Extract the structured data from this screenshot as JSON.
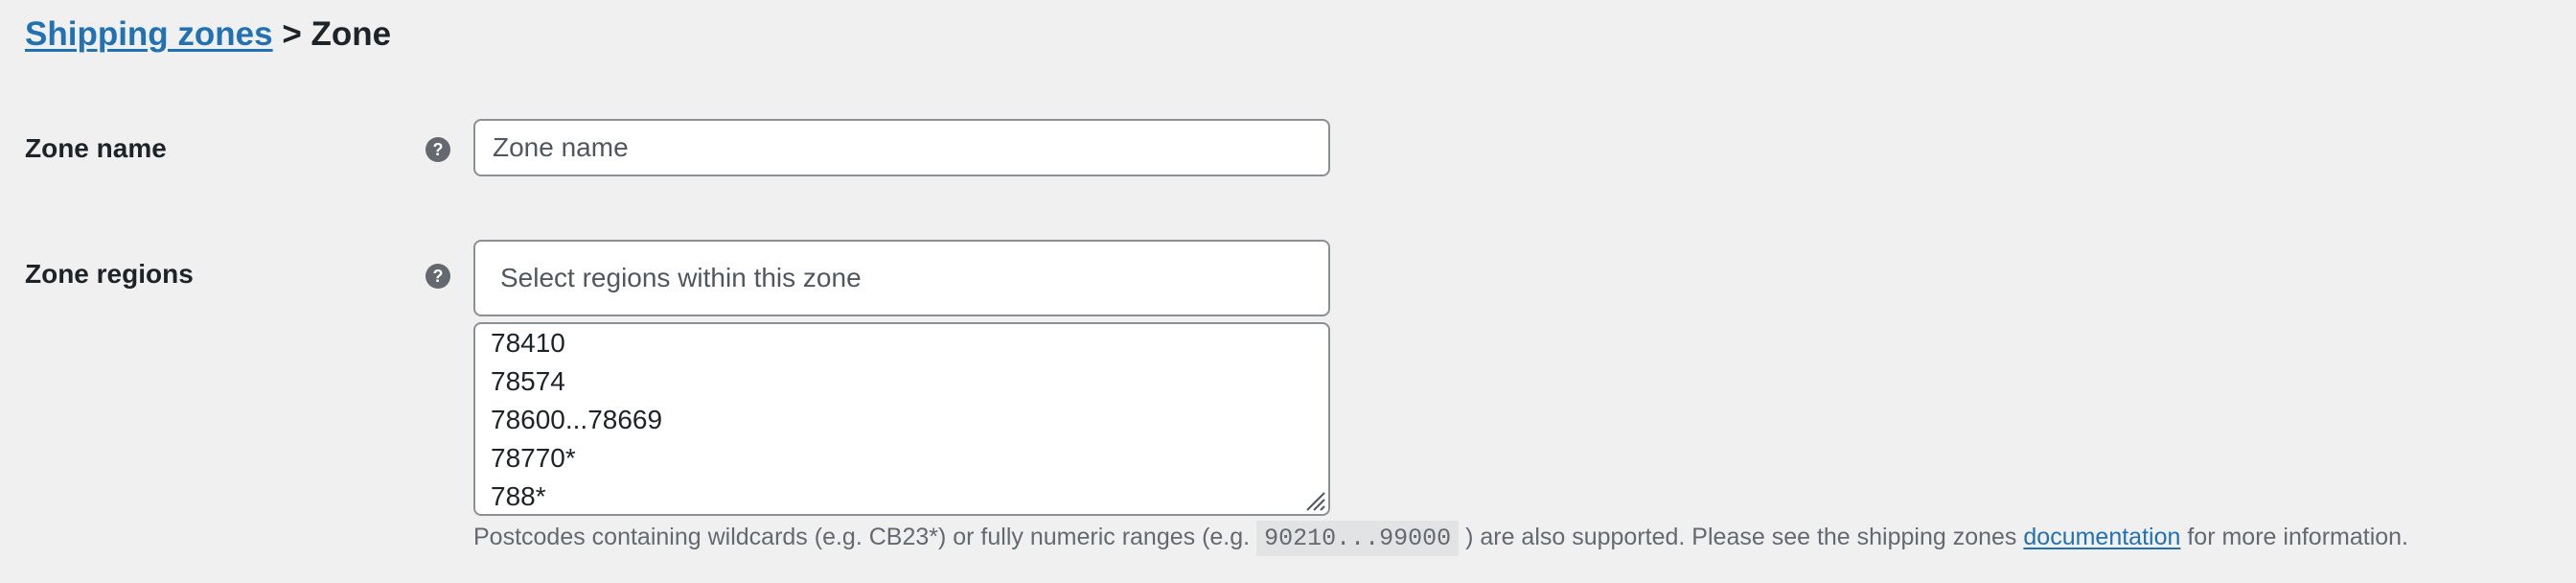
{
  "breadcrumb": {
    "link_label": "Shipping zones",
    "separator": ">",
    "current": "Zone"
  },
  "zone_name": {
    "label": "Zone name",
    "help_icon": "help-icon",
    "value": "",
    "placeholder": "Zone name"
  },
  "zone_regions": {
    "label": "Zone regions",
    "help_icon": "help-icon",
    "select_placeholder": "Select regions within this zone",
    "postcodes": [
      "78410",
      "78574",
      "78600...78669",
      "78770*",
      "788*"
    ]
  },
  "help_text": {
    "before_code": "Postcodes containing wildcards (e.g. CB23*) or fully numeric ranges (e.g.",
    "code": "90210...99000",
    "after_code": ") are also supported. Please see the shipping zones",
    "link": "documentation",
    "after_link": "for more information."
  },
  "colors": {
    "background": "#f0f0f1",
    "link": "#2271b1",
    "border": "#8c8f94",
    "muted_text": "#646970",
    "help_icon_bg": "#646970"
  }
}
